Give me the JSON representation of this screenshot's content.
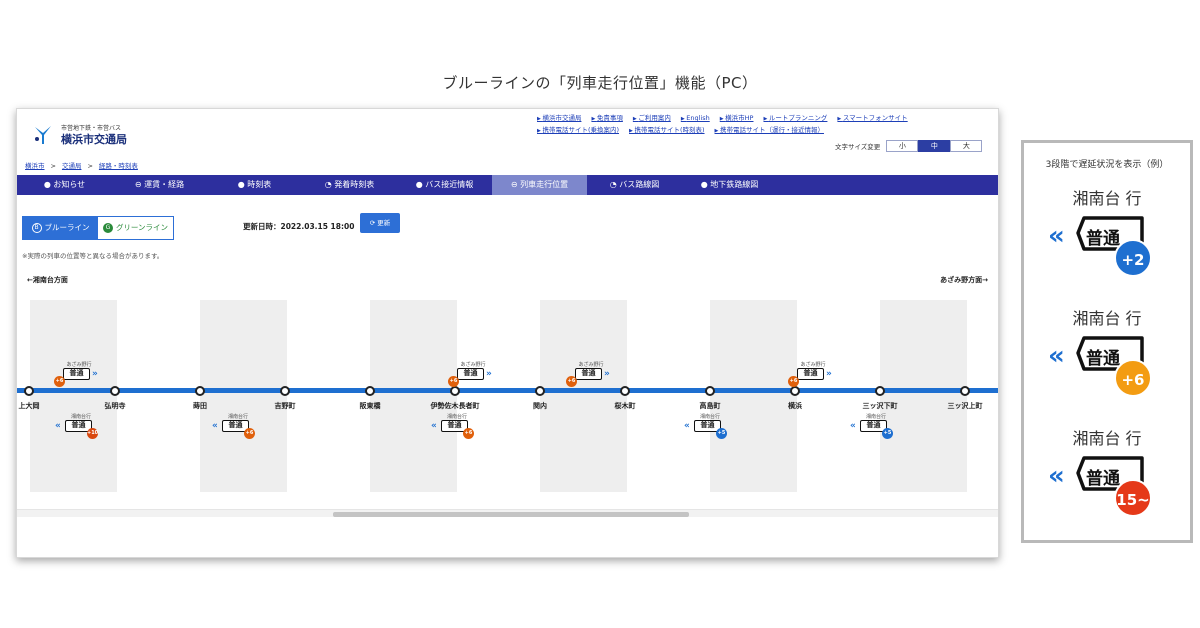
{
  "caption": "ブルーラインの「列車走行位置」機能（PC）",
  "site": {
    "logo_sub": "市営地下鉄・市営バス",
    "logo_main": "横浜市交通局",
    "top_links": [
      "横浜市交通局",
      "免責事項",
      "ご利用案内",
      "English",
      "横浜市HP",
      "ルートプランニング",
      "スマートフォンサイト",
      "携帯電話サイト(乗換案内)",
      "携帯電話サイト(時刻表)",
      "携帯電話サイト（運行・接近情報）"
    ],
    "font_size": {
      "label": "文字サイズ変更",
      "options": [
        "小",
        "中",
        "大"
      ],
      "selected": "中"
    },
    "breadcrumb": [
      "横浜市",
      "交通局",
      "経路・時刻表"
    ],
    "nav": [
      "お知らせ",
      "運賃・経路",
      "時刻表",
      "発着時刻表",
      "バス接近情報",
      "列車走行位置",
      "バス路線図",
      "地下鉄路線図"
    ],
    "nav_active": "列車走行位置",
    "nav_icons": [
      "info-icon",
      "yen-icon",
      "clock-icon",
      "clock-icon",
      "bus-icon",
      "train-icon",
      "bus-icon",
      "subway-icon"
    ]
  },
  "content": {
    "lines": [
      {
        "letter": "B",
        "label": "ブルーライン",
        "active": true
      },
      {
        "letter": "G",
        "label": "グリーンライン",
        "active": false
      }
    ],
    "updated": "更新日時：2022.03.15 18:00",
    "update_button": "更新",
    "note": "※実際の列車の位置等と異なる場合があります。",
    "direction_left": "←湘南台方面",
    "direction_right": "あざみ野方面→",
    "stations": [
      "上大岡",
      "弘明寺",
      "蒔田",
      "吉野町",
      "阪東橋",
      "伊勢佐木長者町",
      "関内",
      "桜木町",
      "高島町",
      "横浜",
      "三ッ沢下町",
      "三ッ沢上町"
    ],
    "trains_up": [
      {
        "dest": "あざみ野行",
        "type": "普通",
        "delay": "+6",
        "color": "#e0600c"
      },
      {
        "dest": "あざみ野行",
        "type": "普通",
        "delay": "+6",
        "color": "#e0600c"
      },
      {
        "dest": "あざみ野行",
        "type": "普通",
        "delay": "+6",
        "color": "#e0600c"
      },
      {
        "dest": "あざみ野行",
        "type": "普通",
        "delay": "+6",
        "color": "#e0600c"
      }
    ],
    "trains_down": [
      {
        "dest": "湘南台行",
        "type": "普通",
        "delay": "+10",
        "color": "#d9480f"
      },
      {
        "dest": "湘南台行",
        "type": "普通",
        "delay": "+6",
        "color": "#e0600c"
      },
      {
        "dest": "湘南台行",
        "type": "普通",
        "delay": "+6",
        "color": "#e0600c"
      },
      {
        "dest": "湘南台行",
        "type": "普通",
        "delay": "+5",
        "color": "#1e6fd0"
      },
      {
        "dest": "湘南台行",
        "type": "普通",
        "delay": "+5",
        "color": "#1e6fd0"
      }
    ]
  },
  "legend": {
    "title": "3段階で遅延状況を表示（例）",
    "items": [
      {
        "dest": "湘南台 行",
        "type": "普通",
        "delay": "+2",
        "color": "#1e6fd0"
      },
      {
        "dest": "湘南台 行",
        "type": "普通",
        "delay": "+6",
        "color": "#f39c12"
      },
      {
        "dest": "湘南台 行",
        "type": "普通",
        "delay": "15~",
        "color": "#e53919"
      }
    ]
  }
}
